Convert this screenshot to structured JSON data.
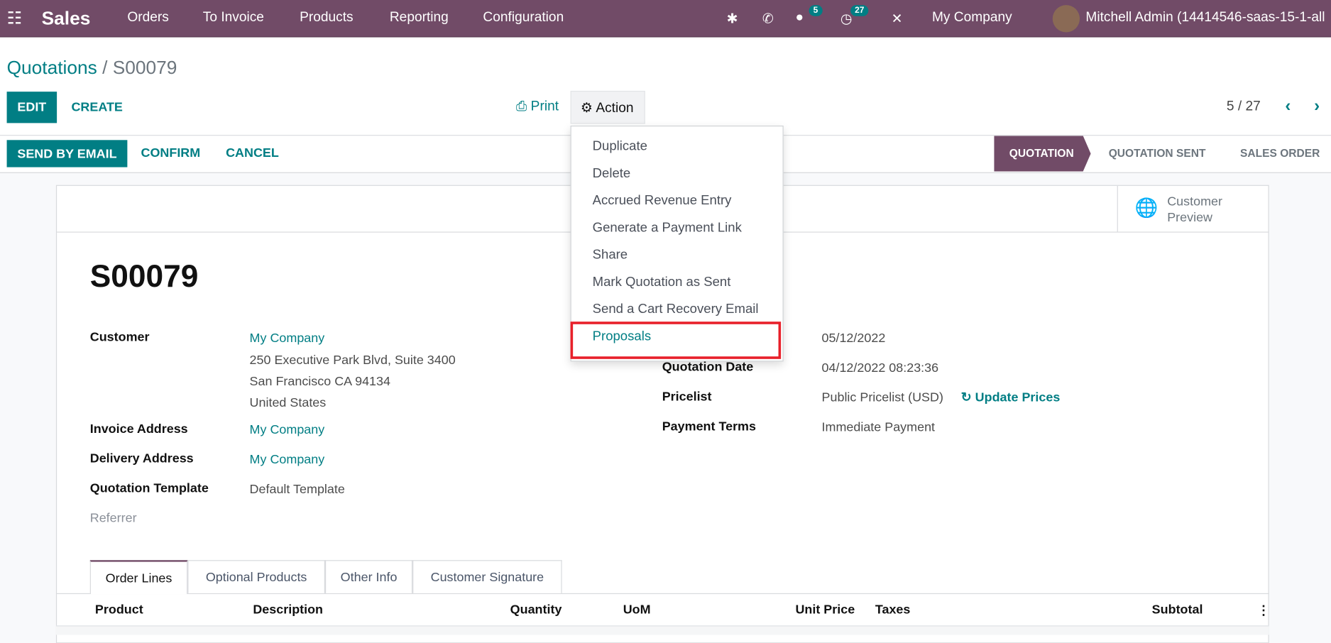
{
  "topbar": {
    "app": "Sales",
    "menu": [
      "Orders",
      "To Invoice",
      "Products",
      "Reporting",
      "Configuration"
    ],
    "messages_count": "5",
    "activities_count": "27",
    "company": "My Company",
    "user": "Mitchell Admin (14414546-saas-15-1-all",
    "color": "#714b67"
  },
  "breadcrumb": {
    "parent": "Quotations",
    "current": "S00079"
  },
  "toolbar": {
    "edit": "EDIT",
    "create": "CREATE",
    "print": "Print",
    "action": "Action",
    "pager": "5 / 27"
  },
  "statusbar": {
    "send": "SEND BY EMAIL",
    "confirm": "CONFIRM",
    "cancel": "CANCEL",
    "stages": [
      "QUOTATION",
      "QUOTATION SENT",
      "SALES ORDER"
    ],
    "active": "QUOTATION"
  },
  "action_menu": [
    "Duplicate",
    "Delete",
    "Accrued Revenue Entry",
    "Generate a Payment Link",
    "Share",
    "Mark Quotation as Sent",
    "Send a Cart Recovery Email",
    "Proposals"
  ],
  "sheet": {
    "customer_preview": "Customer Preview",
    "name": "S00079",
    "left": {
      "customer_label": "Customer",
      "customer": "My Company",
      "address": [
        "250 Executive Park Blvd, Suite 3400",
        "San Francisco CA 94134",
        "United States"
      ],
      "invoice_label": "Invoice Address",
      "invoice": "My Company",
      "delivery_label": "Delivery Address",
      "delivery": "My Company",
      "template_label": "Quotation Template",
      "template": "Default Template",
      "referrer_label": "Referrer"
    },
    "right": {
      "expiration": "05/12/2022",
      "date_label": "Quotation Date",
      "date": "04/12/2022 08:23:36",
      "pricelist_label": "Pricelist",
      "pricelist": "Public Pricelist (USD)",
      "update_prices": "Update Prices",
      "terms_label": "Payment Terms",
      "terms": "Immediate Payment"
    },
    "tabs": [
      "Order Lines",
      "Optional Products",
      "Other Info",
      "Customer Signature"
    ],
    "columns": [
      "Product",
      "Description",
      "Quantity",
      "UoM",
      "Unit Price",
      "Taxes",
      "Subtotal"
    ]
  }
}
